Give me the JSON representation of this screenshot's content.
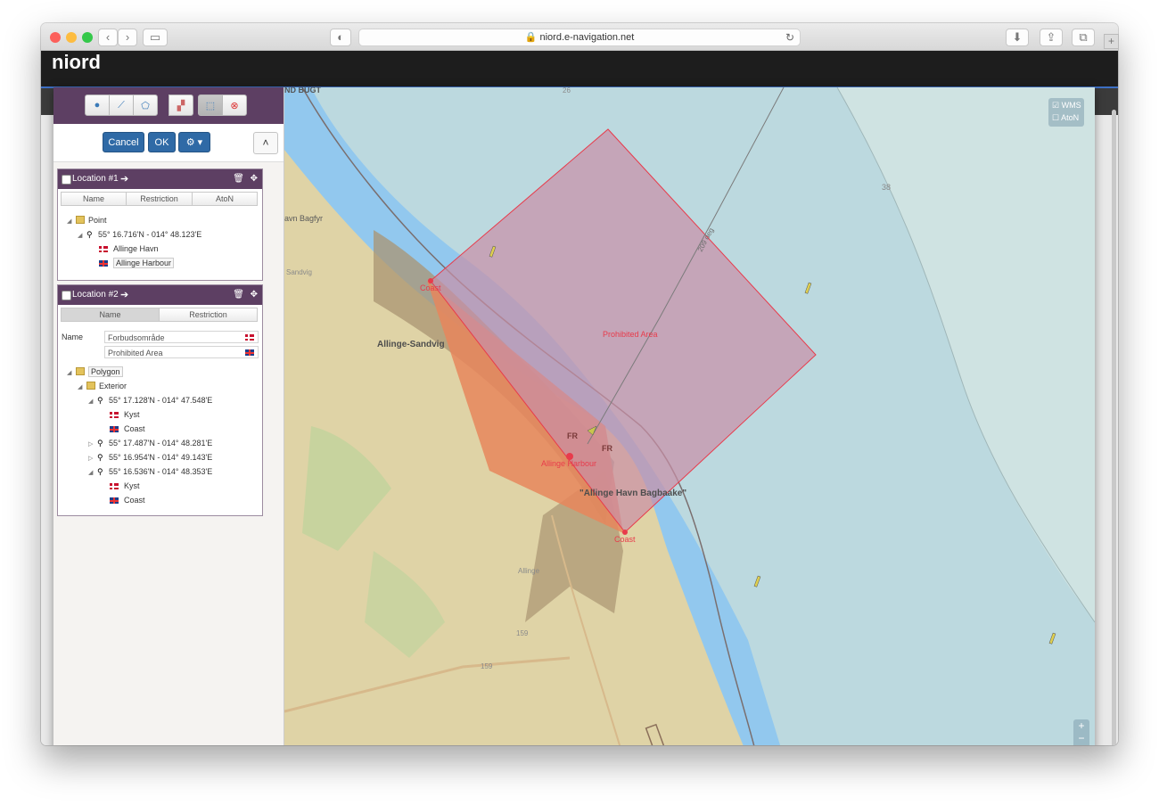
{
  "browser": {
    "url": "niord.e-navigation.net"
  },
  "site": {
    "logo": "niord"
  },
  "toolbar": {
    "cancel": "Cancel",
    "ok": "OK"
  },
  "location1": {
    "title": "Location #1",
    "tabs": [
      "Name",
      "Restriction",
      "AtoN"
    ],
    "tree": {
      "type": "Point",
      "coord": "55° 16.716'N - 014° 48.123'E",
      "names": [
        {
          "lang": "da",
          "text": "Allinge Havn"
        },
        {
          "lang": "en",
          "text": "Allinge Harbour"
        }
      ]
    }
  },
  "location2": {
    "title": "Location #2",
    "tabs": [
      "Name",
      "Restriction"
    ],
    "name_label": "Name",
    "name_da": "Forbudsområde",
    "name_en": "Prohibited Area",
    "tree": {
      "type": "Polygon",
      "exterior": "Exterior",
      "points": [
        {
          "coord": "55° 17.128'N - 014° 47.548'E",
          "da": "Kyst",
          "en": "Coast"
        },
        {
          "coord": "55° 17.487'N - 014° 48.281'E"
        },
        {
          "coord": "55° 16.954'N - 014° 49.143'E"
        },
        {
          "coord": "55° 16.536'N - 014° 48.353'E",
          "da": "Kyst",
          "en": "Coast"
        }
      ]
    }
  },
  "map": {
    "labels": {
      "prohibited": "Prohibited Area",
      "coast_top": "Coast",
      "coast_bottom": "Coast",
      "harbour": "Allinge Harbour",
      "sandvig": "Allinge-Sandvig",
      "bagbaake": "\"Allinge Havn Bagbaake\"",
      "bagfyr": "avn Bagfyr",
      "bugt": "ND BUGT",
      "depth": "38",
      "bearing": "209 deg",
      "fr1": "FR",
      "fr2": "FR",
      "sandvig_small": "Sandvig",
      "allinge_small": "Allinge",
      "road_159a": "159",
      "road_159b": "159",
      "depth_26": "26"
    },
    "layers": {
      "wms": "WMS",
      "aton": "AtoN"
    },
    "colors": {
      "sea": "#bcd9df",
      "shallow": "#92c8ee",
      "land": "#dfd3a6",
      "area_fill": "#c98fa6",
      "area_stroke": "#e83b4b"
    }
  }
}
